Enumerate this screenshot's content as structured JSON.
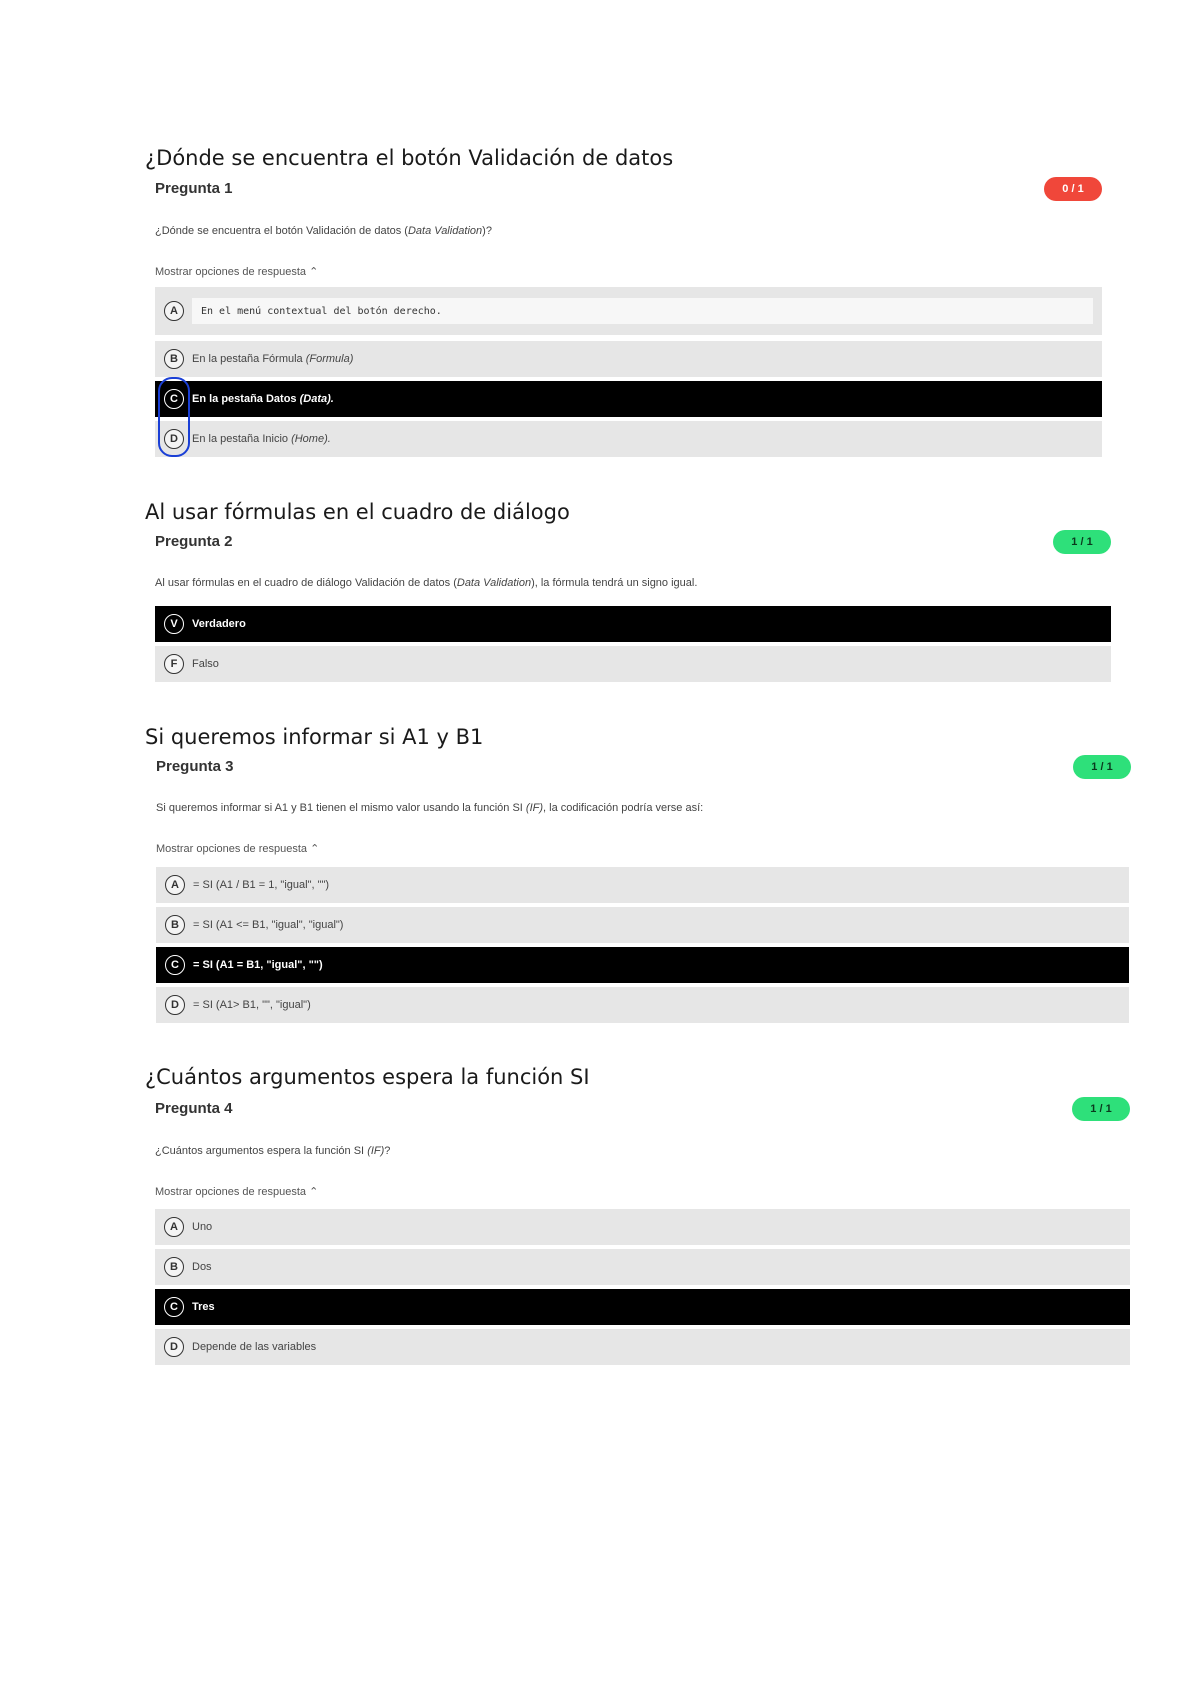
{
  "questions": [
    {
      "heading": "¿Dónde se encuentra el botón Validación de datos",
      "label": "Pregunta 1",
      "score": "0 / 1",
      "text_pre": "¿Dónde se encuentra el botón Validación de datos (",
      "text_italic": "Data Validation",
      "text_post": ")?",
      "toggle": "Mostrar opciones de respuesta ⌃",
      "options": [
        {
          "letter": "A",
          "text": "En el menú contextual del botón derecho."
        },
        {
          "letter": "B",
          "text": "En la pestaña Fórmula ",
          "italic": "(Formula)"
        },
        {
          "letter": "C",
          "text": "En la pestaña Datos ",
          "italic": "(Data)."
        },
        {
          "letter": "D",
          "text": "En la pestaña Inicio ",
          "italic": "(Home)."
        }
      ]
    },
    {
      "heading": "Al usar fórmulas en el cuadro de diálogo",
      "label": "Pregunta 2",
      "score": "1 / 1",
      "text_pre": "Al usar fórmulas en el cuadro de diálogo Validación de datos (",
      "text_italic": "Data Validation",
      "text_post": "), la fórmula tendrá un signo igual.",
      "options": [
        {
          "letter": "V",
          "text": "Verdadero"
        },
        {
          "letter": "F",
          "text": "Falso"
        }
      ]
    },
    {
      "heading": "Si queremos informar si A1 y B1",
      "label": "Pregunta 3",
      "score": "1 / 1",
      "text_pre": "Si queremos informar si A1 y B1 tienen el mismo valor usando la función SI ",
      "text_italic": "(IF)",
      "text_post": ", la codificación podría verse así:",
      "toggle": "Mostrar opciones de respuesta ⌃",
      "options": [
        {
          "letter": "A",
          "text": "= SI (A1 / B1 = 1, \"igual\", \"\")"
        },
        {
          "letter": "B",
          "text": "= SI (A1 <= B1, \"igual\", \"igual\")"
        },
        {
          "letter": "C",
          "text": "= SI (A1 = B1, \"igual\", \"\")"
        },
        {
          "letter": "D",
          "text": "= SI (A1> B1, \"\", \"igual\")"
        }
      ]
    },
    {
      "heading": "¿Cuántos argumentos espera la función SI",
      "label": "Pregunta 4",
      "score": "1 / 1",
      "text_pre": "¿Cuántos argumentos espera la función SI ",
      "text_italic": "(IF)",
      "text_post": "?",
      "toggle": "Mostrar opciones de respuesta ⌃",
      "options": [
        {
          "letter": "A",
          "text": "Uno"
        },
        {
          "letter": "B",
          "text": "Dos"
        },
        {
          "letter": "C",
          "text": "Tres"
        },
        {
          "letter": "D",
          "text": "Depende de las variables"
        }
      ]
    }
  ],
  "colors": {
    "score_wrong": "#f0473a",
    "score_right": "#2ee07a",
    "selected": "#000000",
    "annotation": "#1a3fd6"
  }
}
